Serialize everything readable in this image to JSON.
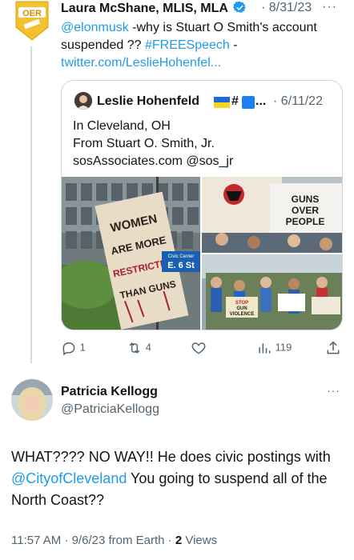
{
  "parent_tweet": {
    "author_name": "Laura McShane, MLIS, MLA",
    "date": "8/31/23",
    "more": "···",
    "avatar_badge": "OER",
    "text_mention": "@elonmusk",
    "text_body": " -why is Stuart O Smith's account suspended ?? ",
    "text_hashtag": "#FREESpeech",
    "text_dash": " -",
    "text_link": "twitter.com/LeslieHohenfel...",
    "verified_color": "#1d9bf0"
  },
  "quote": {
    "author_name": "Leslie Hohenfeld",
    "hash": "#",
    "ellipsis": "...",
    "date": "6/11/22",
    "lines": [
      "In Cleveland, OH",
      "From Stuart O. Smith, Jr.",
      "sosAssociates.com @sos_jr"
    ],
    "sign_main": [
      "WOMEN",
      "ARE MORE",
      "RESTRICTED",
      "THAN GUNS"
    ],
    "street_sign": [
      "Civic Center",
      "E. 6 St"
    ],
    "sign_right": [
      "GUNS",
      "OVER",
      "PEOPLE"
    ],
    "sign_small": [
      "STOP",
      "GUN",
      "VIOLENCE"
    ]
  },
  "actions": {
    "replies": "1",
    "retweets": "4",
    "views": "119"
  },
  "reply": {
    "author_name": "Patricia Kellogg",
    "handle": "@PatriciaKellogg",
    "more": "···",
    "text_1": "WHAT???? NO WAY!! He does civic postings with ",
    "text_mention": "@CityofCleveland",
    "text_2": " You going to suspend all of the North Coast??",
    "time": "11:57 AM · 9/6/23 from Earth · ",
    "views_count": "2",
    "views_label": " Views"
  },
  "colors": {
    "link": "#1d9bf0",
    "secondary": "#536471",
    "border": "#cfd9de"
  }
}
